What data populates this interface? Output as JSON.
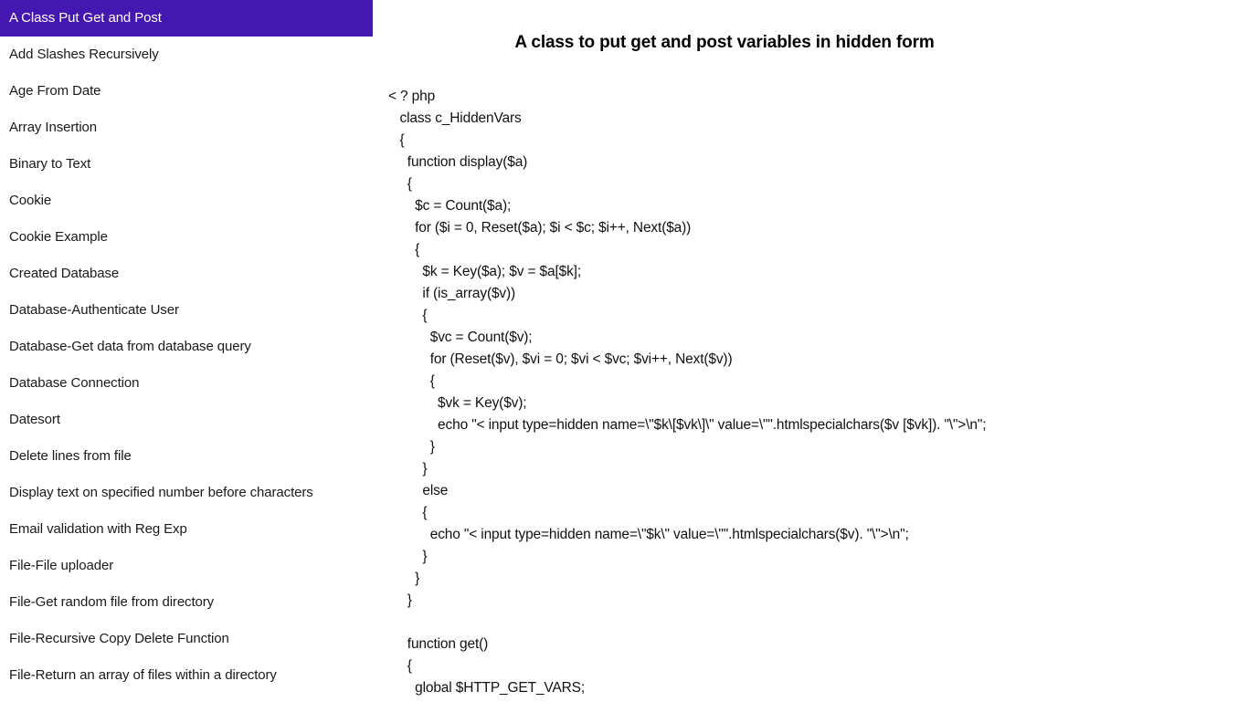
{
  "sidebar": {
    "selected_index": 0,
    "accent_color": "#4417b0",
    "items": [
      {
        "label": "A Class Put Get and Post"
      },
      {
        "label": "Add Slashes Recursively"
      },
      {
        "label": "Age From Date"
      },
      {
        "label": "Array Insertion"
      },
      {
        "label": "Binary to Text"
      },
      {
        "label": "Cookie"
      },
      {
        "label": "Cookie Example"
      },
      {
        "label": "Created Database"
      },
      {
        "label": "Database-Authenticate User"
      },
      {
        "label": "Database-Get data from database query"
      },
      {
        "label": "Database Connection"
      },
      {
        "label": "Datesort"
      },
      {
        "label": "Delete lines from file"
      },
      {
        "label": "Display text on specified number before characters"
      },
      {
        "label": "Email validation with Reg Exp"
      },
      {
        "label": "File-File uploader"
      },
      {
        "label": "File-Get random file from directory"
      },
      {
        "label": "File-Recursive Copy Delete Function"
      },
      {
        "label": "File-Return an array of files within a directory"
      }
    ]
  },
  "main": {
    "title": "A class to put get and post variables in hidden form",
    "code_lines": [
      "< ? php",
      "   class c_HiddenVars",
      "   {",
      "     function display($a)",
      "     {",
      "       $c = Count($a);",
      "       for ($i = 0, Reset($a); $i < $c; $i++, Next($a))",
      "       {",
      "         $k = Key($a); $v = $a[$k];",
      "         if (is_array($v))",
      "         {",
      "           $vc = Count($v);",
      "           for (Reset($v), $vi = 0; $vi < $vc; $vi++, Next($v))",
      "           {",
      "             $vk = Key($v);",
      "             echo \"< input type=hidden name=\\\"$k\\[$vk\\]\\\" value=\\\"\".htmlspecialchars($v [$vk]). \"\\\">\\n\";",
      "           }",
      "         }",
      "         else",
      "         {",
      "           echo \"< input type=hidden name=\\\"$k\\\" value=\\\"\".htmlspecialchars($v). \"\\\">\\n\";",
      "         }",
      "       }",
      "     }",
      "",
      "     function get()",
      "     {",
      "       global $HTTP_GET_VARS;"
    ]
  }
}
